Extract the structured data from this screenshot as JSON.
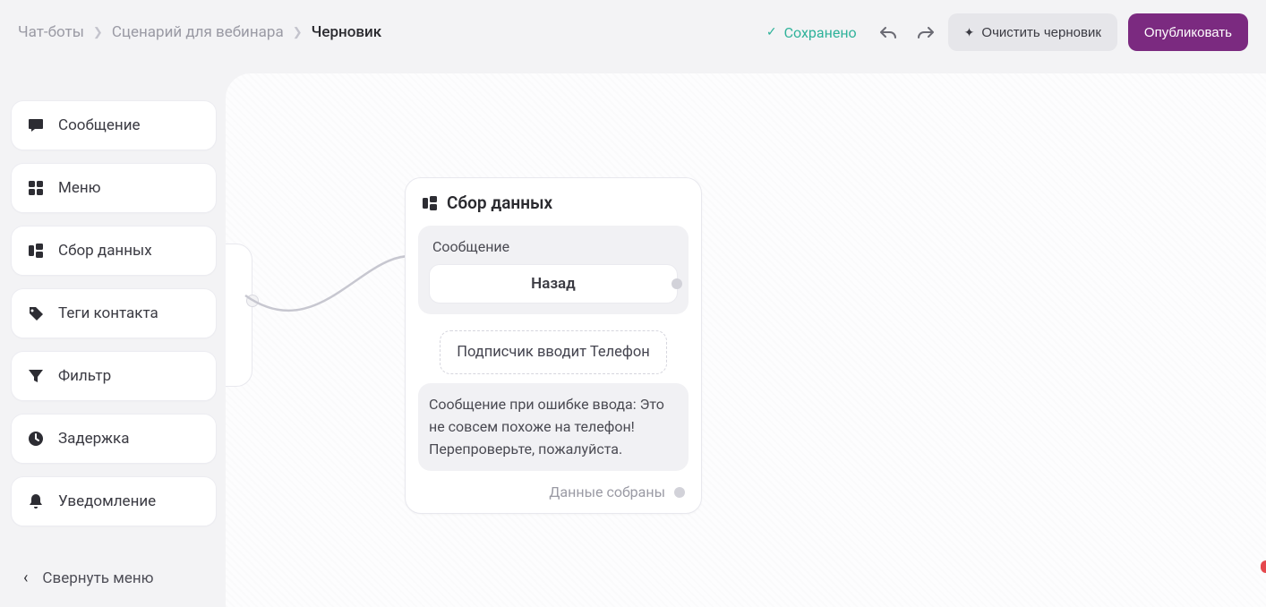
{
  "breadcrumb": {
    "a": "Чат-боты",
    "b": "Сценарий для вебинара",
    "c": "Черновик"
  },
  "header": {
    "saved": "Сохранено",
    "clear_draft": "Очистить черновик",
    "publish": "Опубликовать"
  },
  "sidebar": {
    "items": [
      {
        "label": "Сообщение",
        "name": "sidebar-item-message",
        "icon": "message-icon"
      },
      {
        "label": "Меню",
        "name": "sidebar-item-menu",
        "icon": "grid-icon"
      },
      {
        "label": "Сбор данных",
        "name": "sidebar-item-datacollect",
        "icon": "form-icon"
      },
      {
        "label": "Теги контакта",
        "name": "sidebar-item-tags",
        "icon": "tag-icon"
      },
      {
        "label": "Фильтр",
        "name": "sidebar-item-filter",
        "icon": "funnel-icon"
      },
      {
        "label": "Задержка",
        "name": "sidebar-item-delay",
        "icon": "clock-icon"
      },
      {
        "label": "Уведомление",
        "name": "sidebar-item-notify",
        "icon": "bell-icon"
      }
    ],
    "collapse": "Свернуть меню"
  },
  "node": {
    "title": "Сбор данных",
    "message_label": "Сообщение",
    "back_label": "Назад",
    "input_hint": "Подписчик вводит Телефон",
    "error_text": "Сообщение при ошибке ввода: Это не совсем похоже на телефон! Перепроверьте, пожалуйста.",
    "collected_label": "Данные собраны"
  }
}
